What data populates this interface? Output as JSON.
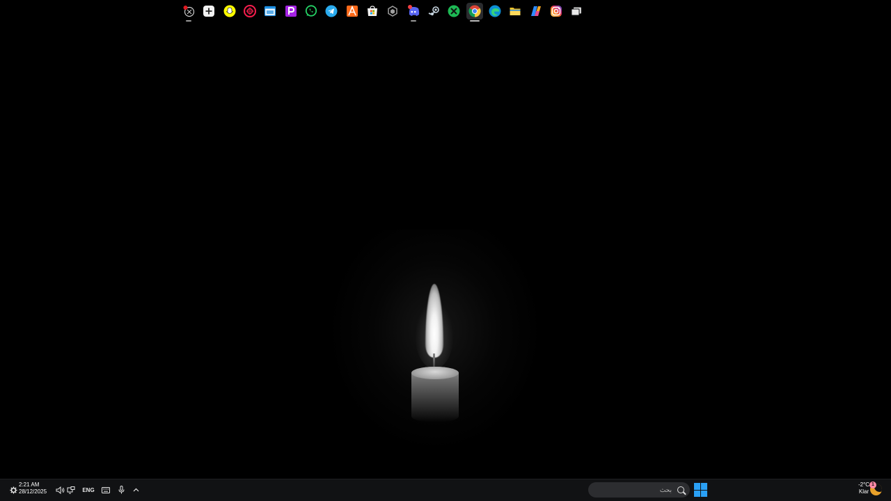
{
  "desktop": {
    "wallpaper": "candle-in-darkness"
  },
  "tray_left": {
    "time": "2:21 AM",
    "date": "28/12/2025",
    "language": "ENG",
    "icons": [
      "gear-icon",
      "speaker-icon",
      "network-icon",
      "keyboard-icon",
      "microphone-icon",
      "chevron-up-icon"
    ]
  },
  "taskbar_apps": [
    {
      "icon": "screen-recorder-icon",
      "color": "#e11b22"
    },
    {
      "icon": "add-icon",
      "color": "#ffffff"
    },
    {
      "icon": "snapchat-icon",
      "color": "#fffc00"
    },
    {
      "icon": "opera-gx-icon",
      "color": "#fa1e4e"
    },
    {
      "icon": "window-app-icon",
      "color": "#1c8fe3"
    },
    {
      "icon": "purple-p-app-icon",
      "color": "#a522e4"
    },
    {
      "icon": "whatsapp-icon",
      "color": "#25d366"
    },
    {
      "icon": "telegram-icon",
      "color": "#2aabee"
    },
    {
      "icon": "orange-a-app-icon",
      "color": "#ff6a1a"
    },
    {
      "icon": "microsoft-store-icon",
      "color": "#f25022"
    },
    {
      "icon": "hexagon-app-icon",
      "color": "#a0a0a0"
    },
    {
      "icon": "discord-icon",
      "color": "#5865f2"
    },
    {
      "icon": "steam-icon",
      "color": "#c7d5e0"
    },
    {
      "icon": "green-app-icon",
      "color": "#1db954"
    },
    {
      "icon": "chrome-icon",
      "color": "#4285f4"
    },
    {
      "icon": "edge-icon",
      "color": "#0c8fd6"
    },
    {
      "icon": "file-explorer-icon",
      "color": "#f8c62c"
    },
    {
      "icon": "copilot-icon",
      "color": "#f9a825"
    },
    {
      "icon": "instagram-icon",
      "color": "#e1306c"
    },
    {
      "icon": "task-view-icon",
      "color": "#d0d0d0"
    }
  ],
  "search": {
    "placeholder": "بحث"
  },
  "start": {
    "icon": "windows-start-icon",
    "color": "#2aa0f5"
  },
  "weather": {
    "temperature": "-2°C",
    "condition": "Klar",
    "badge": "1",
    "icon": "moon-icon"
  }
}
